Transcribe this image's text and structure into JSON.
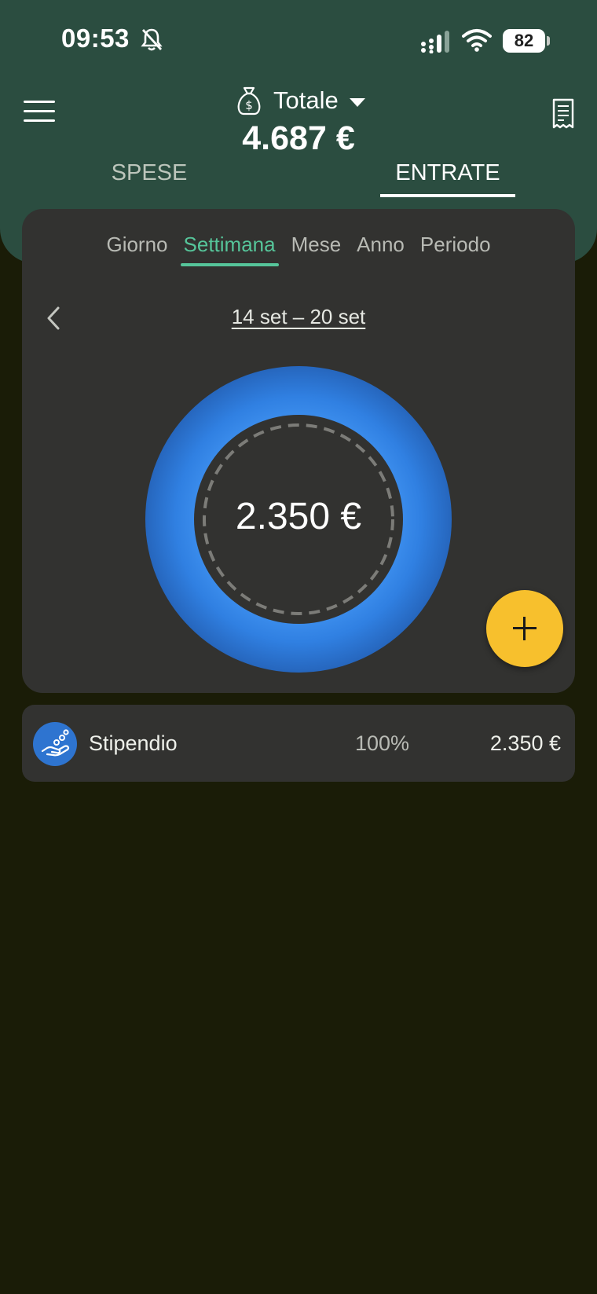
{
  "status_bar": {
    "time": "09:53",
    "battery": "82"
  },
  "header": {
    "account": "Totale",
    "total": "4.687 €",
    "tabs": [
      {
        "label": "SPESE",
        "active": false
      },
      {
        "label": "ENTRATE",
        "active": true
      }
    ]
  },
  "period": {
    "tabs": [
      {
        "label": "Giorno",
        "active": false
      },
      {
        "label": "Settimana",
        "active": true
      },
      {
        "label": "Mese",
        "active": false
      },
      {
        "label": "Anno",
        "active": false
      },
      {
        "label": "Periodo",
        "active": false
      }
    ],
    "range": "14 set – 20 set"
  },
  "chart_data": {
    "type": "pie",
    "categories": [
      "Stipendio"
    ],
    "values": [
      2350
    ],
    "center_label": "2.350 €",
    "colors": [
      "#2e74d0"
    ]
  },
  "categories": [
    {
      "name": "Stipendio",
      "percent": "100%",
      "amount": "2.350 €",
      "color": "#2e74d0",
      "icon": "hand-coins-icon"
    }
  ],
  "icons": {
    "menu": "menu-icon",
    "receipt": "receipt-icon",
    "bag": "money-bag-icon",
    "bell": "bell-off-icon",
    "prev": "chevron-left-icon",
    "fab": "plus-icon"
  },
  "colors": {
    "header_bg": "#2b4d40",
    "background": "#1a1c07",
    "card": "#323230",
    "accent": "#56c59a",
    "fab": "#f7c02d"
  }
}
